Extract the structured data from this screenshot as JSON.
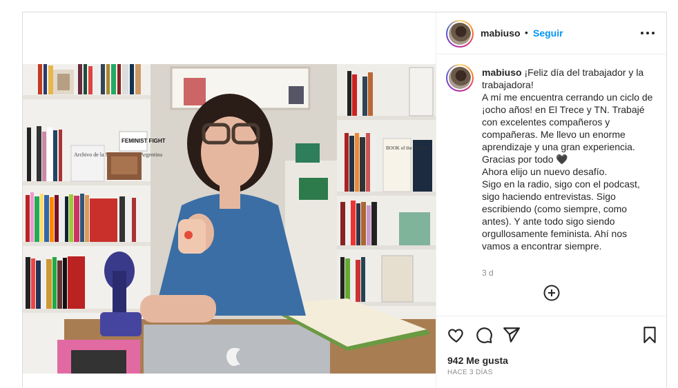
{
  "post": {
    "username": "mabiuso",
    "dot": "•",
    "follow_label": "Seguir",
    "caption_username": "mabiuso",
    "caption_text": " ¡Feliz día del trabajador y la trabajadora!\nA mí me encuentra cerrando un ciclo de ¡ocho años! en El Trece y TN. Trabajé con excelentes compañeros y compañeras. Me llevo un enorme aprendizaje y una gran experiencia. Gracias por todo 🖤\nAhora elijo un nuevo desafío.\nSigo en la radio, sigo con el podcast, sigo haciendo entrevistas. Sigo escribiendo (como siempre, como antes). Y ante todo sigo siendo orgullosamente feminista. Ahí nos vamos a encontrar siempre.",
    "caption_time": "3 d",
    "likes": "942 Me gusta",
    "posted_ago": "HACE 3 DÍAS"
  },
  "photo_text": {
    "book_1": "Archivo de la Memoria Trans Argentina",
    "book_2": "FEMINIST FIGHT",
    "book_3": "BOOK of the DEAD"
  },
  "icons": {
    "more": "more-options-icon",
    "add": "plus-circle-icon",
    "like": "heart-icon",
    "comment": "comment-icon",
    "share": "paper-plane-icon",
    "save": "bookmark-icon"
  },
  "colors": {
    "follow": "#0095f6",
    "text": "#262626",
    "muted": "#8e8e8e"
  }
}
